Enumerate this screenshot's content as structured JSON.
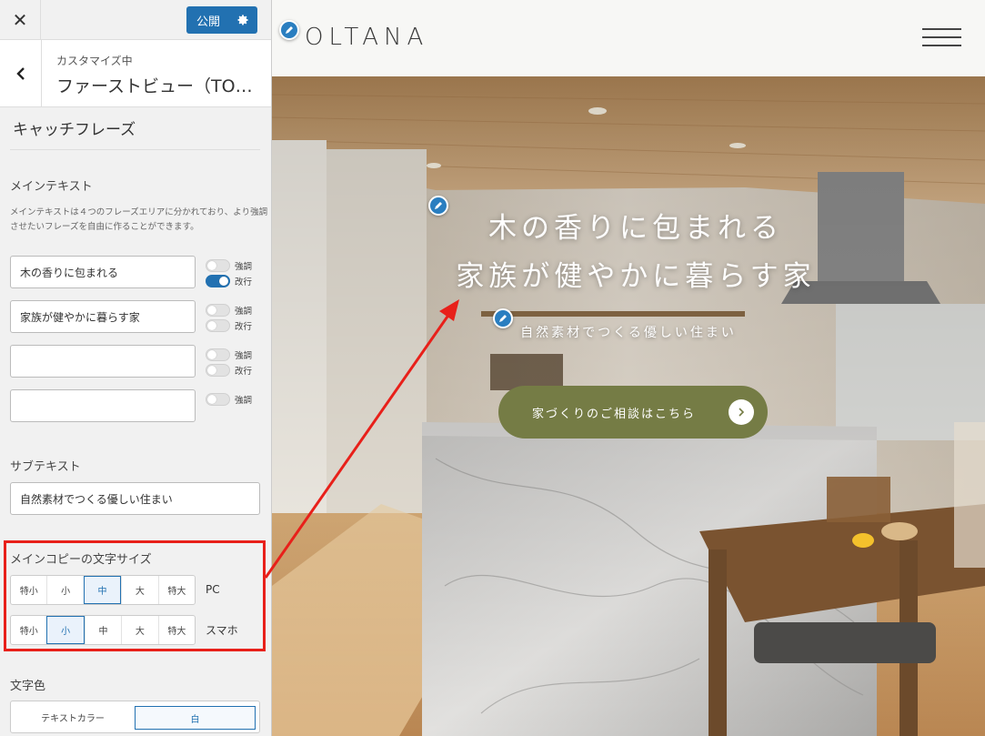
{
  "topbar": {
    "close_glyph": "✕",
    "publish_label": "公開"
  },
  "section": {
    "subtitle": "カスタマイズ中",
    "title": "ファーストビュー（TO…"
  },
  "panel": {
    "title": "キャッチフレーズ",
    "main_text": {
      "label": "メインテキスト",
      "description": "メインテキストは４つのフレーズエリアに分かれており、より強調させたいフレーズを自由に作ることができます。",
      "phrases": [
        {
          "value": "木の香りに包まれる",
          "emphasis": false,
          "linebreak": true
        },
        {
          "value": "家族が健やかに暮らす家",
          "emphasis": false,
          "linebreak": false
        },
        {
          "value": "",
          "emphasis": false,
          "linebreak": false
        },
        {
          "value": "",
          "emphasis": false
        }
      ],
      "emphasis_label": "強調",
      "linebreak_label": "改行"
    },
    "sub_text": {
      "label": "サブテキスト",
      "value": "自然素材でつくる優しい住まい"
    },
    "font_size": {
      "label": "メインコピーの文字サイズ",
      "options": [
        "特小",
        "小",
        "中",
        "大",
        "特大"
      ],
      "pc_label": "PC",
      "pc_selected": "中",
      "sp_label": "スマホ",
      "sp_selected": "小"
    },
    "text_color": {
      "label": "文字色",
      "field_label": "テキストカラー",
      "value": "白"
    }
  },
  "preview": {
    "logo": "OLTANA",
    "catch_line1": "木の香りに包まれる",
    "catch_line2": "家族が健やかに暮らす家",
    "subcopy": "自然素材でつくる優しい住まい",
    "cta_label": "家づくりのご相談はこちら"
  },
  "colors": {
    "accent_blue": "#2271b1",
    "highlight_red": "#e8201a",
    "cta_olive": "#757c45"
  },
  "icons": [
    "close-icon",
    "gear-icon",
    "chevron-left-icon",
    "pencil-icon",
    "hamburger-menu-icon",
    "chevron-right-icon"
  ]
}
